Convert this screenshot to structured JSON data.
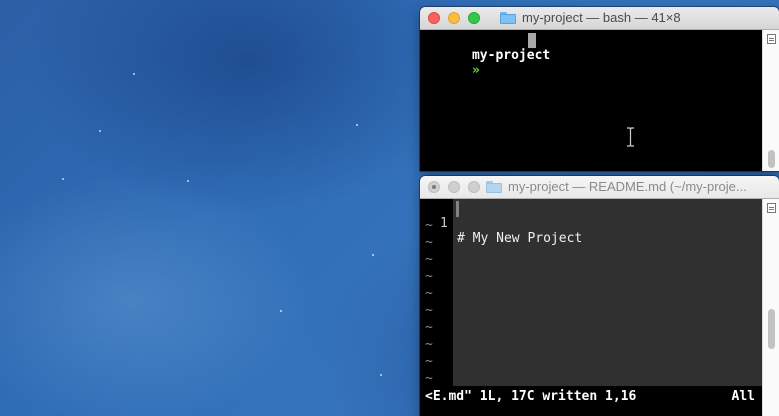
{
  "windows": {
    "bash": {
      "title": "my-project — bash — 41×8",
      "prompt": "my-project",
      "prompt_symbol": "»"
    },
    "vim": {
      "title": "my-project — README.md (~/my-proje...",
      "line_number": "1",
      "line_text": "# My New Project",
      "tilde": "~",
      "status_left": "<E.md\" 1L, 17C written 1,16",
      "status_right": "All"
    }
  },
  "colors": {
    "prompt_symbol": "#6ad84b",
    "vim_bg": "#303030",
    "line_number": "#c8c8c8"
  },
  "icons": [
    "folder-icon",
    "text-cursor-icon",
    "split-pane-icon"
  ]
}
